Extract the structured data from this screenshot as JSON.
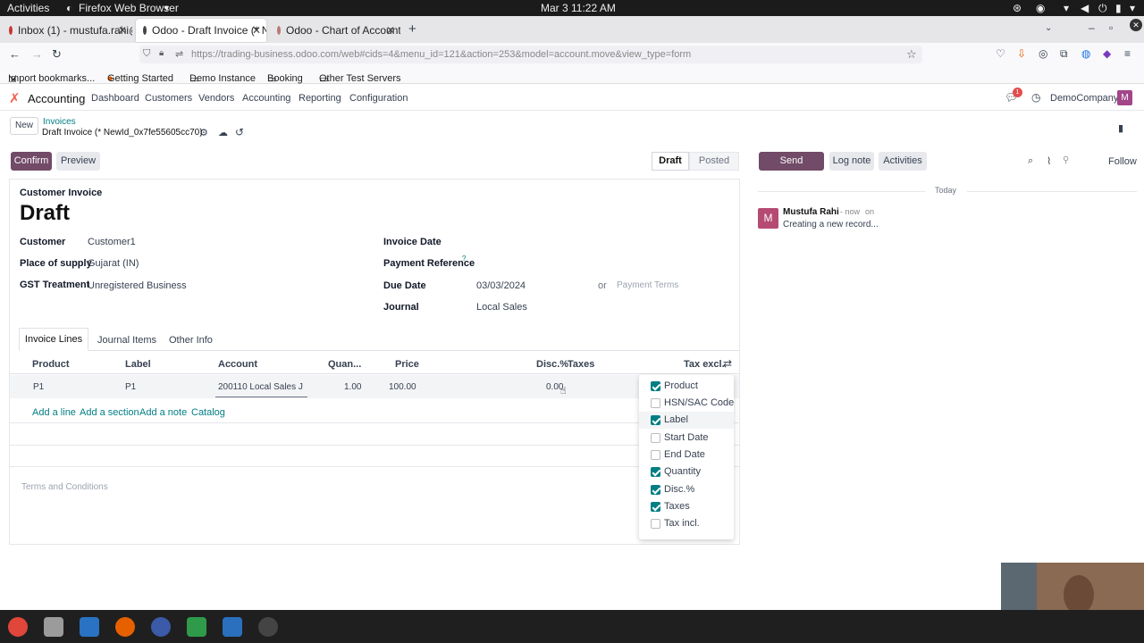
{
  "system": {
    "activities": "Activities",
    "app": "Firefox Web Browser",
    "datetime": "Mar 3  11:22 AM"
  },
  "browser": {
    "tabs": [
      {
        "label": "Inbox (1) - mustufa.rahi@"
      },
      {
        "label": "Odoo - Draft Invoice (* N"
      },
      {
        "label": "Odoo - Chart of Accounts"
      }
    ],
    "url": "https://trading-business.odoo.com/web#cids=4&menu_id=121&action=253&model=account.move&view_type=form",
    "bookmarks": [
      "Import bookmarks...",
      "Getting Started",
      "Demo Instance",
      "Booking",
      "Other Test Servers"
    ]
  },
  "odoo": {
    "app_name": "Accounting",
    "menu": [
      "Dashboard",
      "Customers",
      "Vendors",
      "Accounting",
      "Reporting",
      "Configuration"
    ],
    "company": "DemoCompany",
    "avatar_letter": "M",
    "notif_count": "1"
  },
  "control": {
    "new": "New",
    "breadcrumb": "Invoices",
    "record": "Draft Invoice (* NewId_0x7fe55605cc70)",
    "confirm": "Confirm",
    "preview": "Preview",
    "status": [
      "Draft",
      "Posted"
    ]
  },
  "chatter": {
    "send": "Send message",
    "log": "Log note",
    "activities": "Activities",
    "follow": "Follow",
    "today": "Today",
    "author": "Mustufa Rahi",
    "time": "- now",
    "on": "on",
    "msg": "Creating a new record...",
    "avatar": "M"
  },
  "form": {
    "type": "Customer Invoice",
    "state": "Draft",
    "customer_label": "Customer",
    "customer": "Customer1",
    "pos_label": "Place of supply",
    "pos": "Gujarat (IN)",
    "gst_label": "GST Treatment",
    "gst": "Unregistered Business",
    "inv_date_label": "Invoice Date",
    "payref_label": "Payment Reference",
    "payref_help": "?",
    "due_label": "Due Date",
    "due": "03/03/2024",
    "or": "or",
    "terms_ph": "Payment Terms",
    "journal_label": "Journal",
    "journal": "Local Sales",
    "tabs": [
      "Invoice Lines",
      "Journal Items",
      "Other Info"
    ],
    "cols": [
      "Product",
      "Label",
      "Account",
      "Quan...",
      "Price",
      "Disc.%",
      "Taxes",
      "Tax excl."
    ],
    "line": {
      "product": "P1",
      "label": "P1",
      "account": "200110 Local Sales J",
      "qty": "1.00",
      "price": "100.00",
      "disc": "0.00"
    },
    "actions": [
      "Add a line",
      "Add a section",
      "Add a note",
      "Catalog"
    ],
    "terms": "Terms and Conditions"
  },
  "columns_menu": [
    {
      "label": "Product",
      "checked": true
    },
    {
      "label": "HSN/SAC Code",
      "checked": false
    },
    {
      "label": "Label",
      "checked": true
    },
    {
      "label": "Start Date",
      "checked": false
    },
    {
      "label": "End Date",
      "checked": false
    },
    {
      "label": "Quantity",
      "checked": true
    },
    {
      "label": "Disc.%",
      "checked": true
    },
    {
      "label": "Taxes",
      "checked": true
    },
    {
      "label": "Tax incl.",
      "checked": false
    }
  ]
}
